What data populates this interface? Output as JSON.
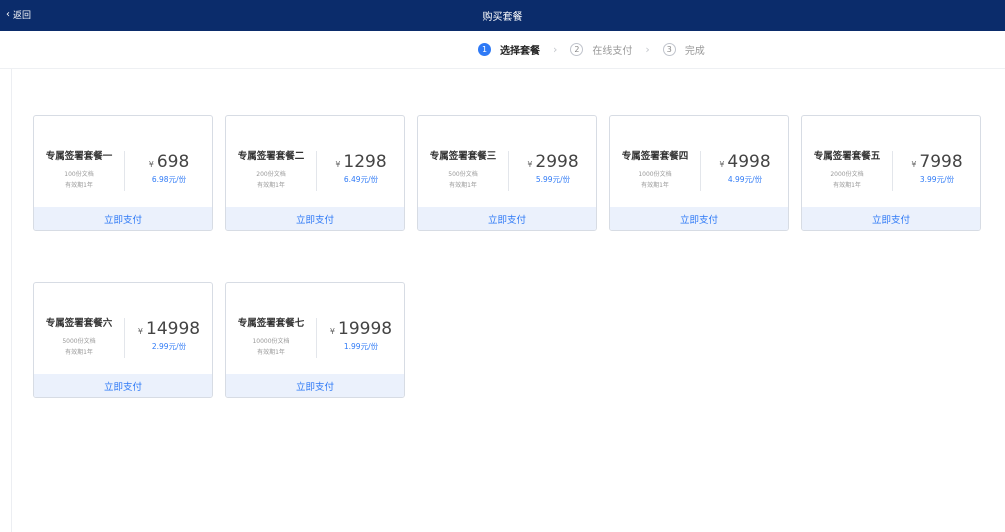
{
  "header": {
    "back_label": "返回",
    "title": "购买套餐"
  },
  "steps": [
    {
      "num": "1",
      "label": "选择套餐"
    },
    {
      "num": "2",
      "label": "在线支付"
    },
    {
      "num": "3",
      "label": "完成"
    }
  ],
  "currency": "¥",
  "pay_label": "立即支付",
  "packages": [
    {
      "name": "专属签署套餐一",
      "docs": "100份文档",
      "validity": "有效期1年",
      "price": "698",
      "unit_price": "6.98元/份"
    },
    {
      "name": "专属签署套餐二",
      "docs": "200份文档",
      "validity": "有效期1年",
      "price": "1298",
      "unit_price": "6.49元/份"
    },
    {
      "name": "专属签署套餐三",
      "docs": "500份文档",
      "validity": "有效期1年",
      "price": "2998",
      "unit_price": "5.99元/份"
    },
    {
      "name": "专属签署套餐四",
      "docs": "1000份文档",
      "validity": "有效期1年",
      "price": "4998",
      "unit_price": "4.99元/份"
    },
    {
      "name": "专属签署套餐五",
      "docs": "2000份文档",
      "validity": "有效期1年",
      "price": "7998",
      "unit_price": "3.99元/份"
    },
    {
      "name": "专属签署套餐六",
      "docs": "5000份文档",
      "validity": "有效期1年",
      "price": "14998",
      "unit_price": "2.99元/份"
    },
    {
      "name": "专属签署套餐七",
      "docs": "10000份文档",
      "validity": "有效期1年",
      "price": "19998",
      "unit_price": "1.99元/份"
    }
  ]
}
